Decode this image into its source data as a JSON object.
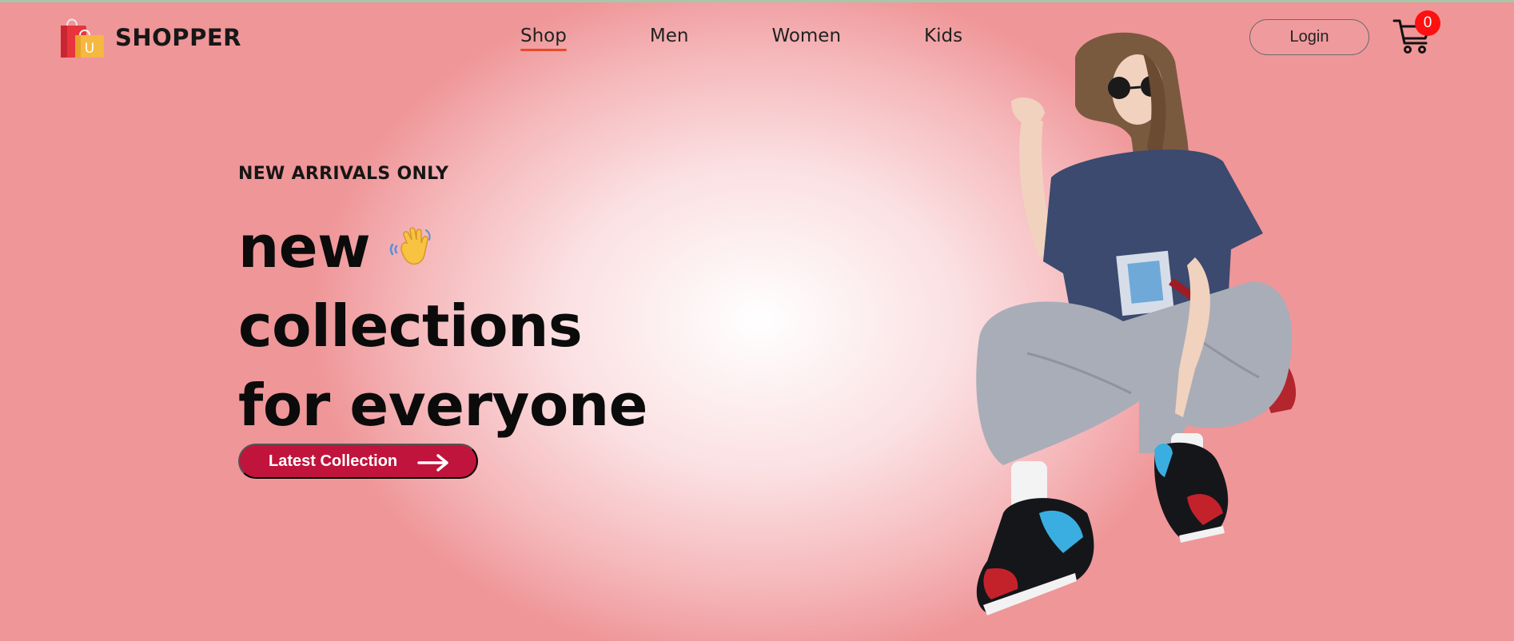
{
  "brand": {
    "name": "SHOPPER",
    "logo_letter": "U"
  },
  "nav": {
    "items": [
      {
        "label": "Shop",
        "active": true
      },
      {
        "label": "Men",
        "active": false
      },
      {
        "label": "Women",
        "active": false
      },
      {
        "label": "Kids",
        "active": false
      }
    ],
    "login_label": "Login",
    "cart_count": "0"
  },
  "hero": {
    "eyebrow": "NEW ARRIVALS ONLY",
    "line1": "new",
    "line2": "collections",
    "line3": "for everyone",
    "cta_label": "Latest Collection"
  },
  "colors": {
    "accent": "#c0143c",
    "badge": "#ff1010",
    "nav_underline": "#e84a2a"
  },
  "icons": {
    "logo": "shopping-bag-icon",
    "wave": "waving-hand-icon",
    "cart": "cart-icon",
    "arrow": "arrow-right-icon"
  }
}
